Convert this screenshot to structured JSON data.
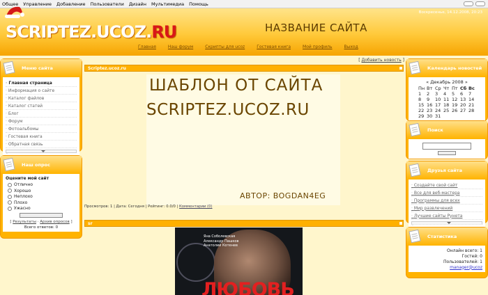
{
  "menubar": {
    "items": [
      "Общее",
      "Управление",
      "Добавление",
      "Пользователи",
      "Дизайн",
      "Мультимедиа",
      "Помощь"
    ]
  },
  "header": {
    "date": "Воскресенье, 14.12.2008, 20:23",
    "logo_main": "SCRIPTEZ.UCOZ.",
    "logo_red": "RU",
    "site_title": "НАЗВАНИЕ САЙТА",
    "nav": [
      "Главная",
      "Наш форум",
      "Скрипты для ucoz",
      "Гостевая книга",
      "Мой профиль",
      "Выход"
    ]
  },
  "left": {
    "menu_title": "Меню сайта",
    "menu_items": [
      "Главная страница",
      "Информация о сайте",
      "Каталог файлов",
      "Каталог статей",
      "Блог",
      "Форум",
      "Фотоальбомы",
      "Гостевая книга",
      "Обратная связь"
    ],
    "poll_title": "Наш опрос",
    "poll_question": "Оцените мой сайт",
    "poll_options": [
      "Отлично",
      "Хорошо",
      "Неплохо",
      "Плохо",
      "Ужасно"
    ],
    "poll_results": "Результаты",
    "poll_archive": "Архив опросов",
    "poll_total": "Всего ответов: 0"
  },
  "center": {
    "add_news": "Добавить новость",
    "news1_title": "Scriptez.ucoz.ru",
    "banner_line1": "ШАБЛОН ОТ САЙТА",
    "banner_line2": "SCRIPTEZ.UCOZ.RU",
    "banner_author": "АВТОР: BOGDAN4EG",
    "details_text": "Просмотров: 1 | Дата: Сегодня | Рейтинг: 0.0/0 | ",
    "details_comments": "Комментарии (0)",
    "news2_title": "sr",
    "poster_cast": [
      "Яна Соболевская",
      "Александр Пашков",
      "Анатолий Котенев"
    ],
    "poster_title": "ЛЮБОВЬ"
  },
  "right": {
    "calendar_title": "Календарь новостей",
    "calendar_month": "« Декабрь 2008 »",
    "calendar_days": [
      "Пн",
      "Вт",
      "Ср",
      "Чт",
      "Пт",
      "Сб",
      "Вс"
    ],
    "calendar_weeks": [
      [
        "1",
        "2",
        "3",
        "4",
        "5",
        "6",
        "7"
      ],
      [
        "8",
        "9",
        "10",
        "11",
        "12",
        "13",
        "14"
      ],
      [
        "15",
        "16",
        "17",
        "18",
        "19",
        "20",
        "21"
      ],
      [
        "22",
        "23",
        "24",
        "25",
        "26",
        "27",
        "28"
      ],
      [
        "29",
        "30",
        "31",
        "",
        "",
        "",
        ""
      ]
    ],
    "search_title": "Поиск",
    "friends_title": "Друзья сайта",
    "friends_links": [
      "Создайте свой сайт",
      "Все для веб-мастера",
      "Программы для всех",
      "Мир развлечений",
      "Лучшие сайты Рунета"
    ],
    "stats_title": "Статистика",
    "stats_online": "Онлайн всего: 1",
    "stats_guests": "Гостей: 0",
    "stats_users": "Пользователей: 1",
    "stats_user_link": "manager@ucoz"
  }
}
